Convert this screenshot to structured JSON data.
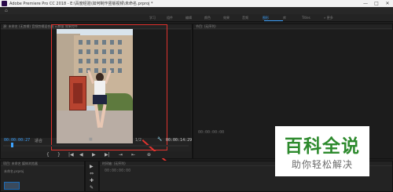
{
  "window": {
    "title": "Adobe Premiere Pro CC 2018 - E:\\百度经验\\如何制作竖版视频\\未命名.prproj *",
    "controls": [
      "—",
      "□",
      "✕"
    ]
  },
  "workspace_tabs": {
    "items": [
      "学习",
      "组件",
      "编辑",
      "颜色",
      "效果",
      "音频",
      "图形",
      "库",
      "Titles",
      "» 更多"
    ],
    "active": "图形"
  },
  "source_monitor": {
    "header": "源: 未命名 (无剪辑)  音频剪辑混合器  元数据  效果控件",
    "timecode_left": "00:00:00:27",
    "fit_label": "适合",
    "fraction": "1/2",
    "timecode_right": "00:00:14:29",
    "playhead_fraction": 0.04
  },
  "program_monitor": {
    "header": "节目: (无序列)",
    "timecode": "00:00:00:00"
  },
  "project_panel": {
    "header": "项目: 未命名  媒体浏览器",
    "item": "未命名.prproj"
  },
  "timeline_panel": {
    "header": "时间轴: (无序列)",
    "timecode": "00:00:00:00"
  },
  "tools": [
    "▶",
    "⇔",
    "✚",
    "✎"
  ],
  "transport": [
    "{",
    "}",
    "|◀",
    "◀",
    "▶",
    "▶|",
    "⇥",
    "⇤",
    "⊕"
  ],
  "watermark": {
    "title": "百科全说",
    "subtitle": "助你轻松解决"
  }
}
